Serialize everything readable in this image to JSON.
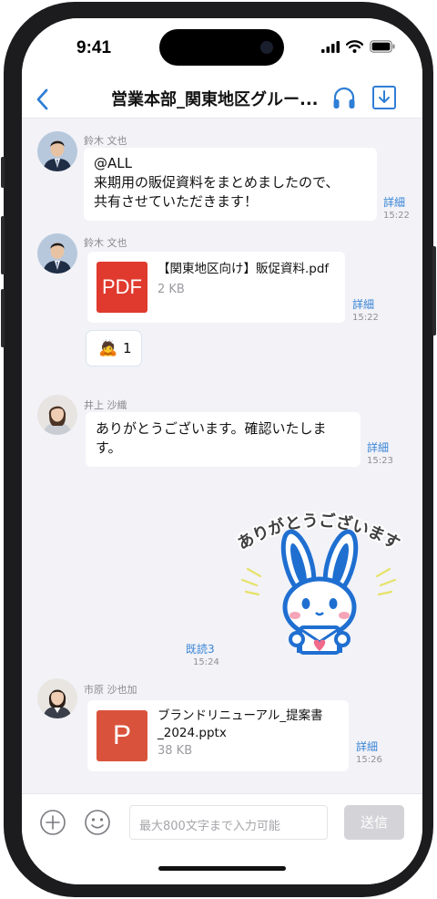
{
  "status_bar": {
    "time": "9:41"
  },
  "nav": {
    "title": "営業本部_関東地区グルー..."
  },
  "messages": {
    "m1": {
      "sender": "鈴木 文也",
      "lines": [
        "@ALL",
        "来期用の販促資料をまとめましたので、",
        "共有させていただきます！"
      ],
      "detail": "詳細",
      "time": "15:22"
    },
    "m2": {
      "sender": "鈴木 文也",
      "file_name": "【関東地区向け】販促資料.pdf",
      "file_size": "2 KB",
      "file_icon": "PDF",
      "detail": "詳細",
      "time": "15:22",
      "reaction_emoji": "🙇",
      "reaction_count": "1"
    },
    "m3": {
      "sender": "井上 沙織",
      "lines": [
        "ありがとうございます。確認いたしま",
        "す。"
      ],
      "detail": "詳細",
      "time": "15:23"
    },
    "m4": {
      "sticker_text": "ありがとうございます",
      "read": "既読3",
      "time": "15:24"
    },
    "m5": {
      "sender": "市原 沙也加",
      "file_name_lines": [
        "ブランドリニューアル_提案書",
        "_2024.pptx"
      ],
      "file_size": "38 KB",
      "file_icon": "P",
      "detail": "詳細",
      "time": "15:26"
    }
  },
  "input": {
    "placeholder": "最大800文字まで入力可能",
    "send_label": "送信"
  },
  "colors": {
    "accent": "#3a85d6",
    "pdf_red": "#e03a2e",
    "ppt_orange": "#d9533c",
    "chat_bg": "#f2f2f7",
    "sticker_blue": "#1f6fd1"
  }
}
